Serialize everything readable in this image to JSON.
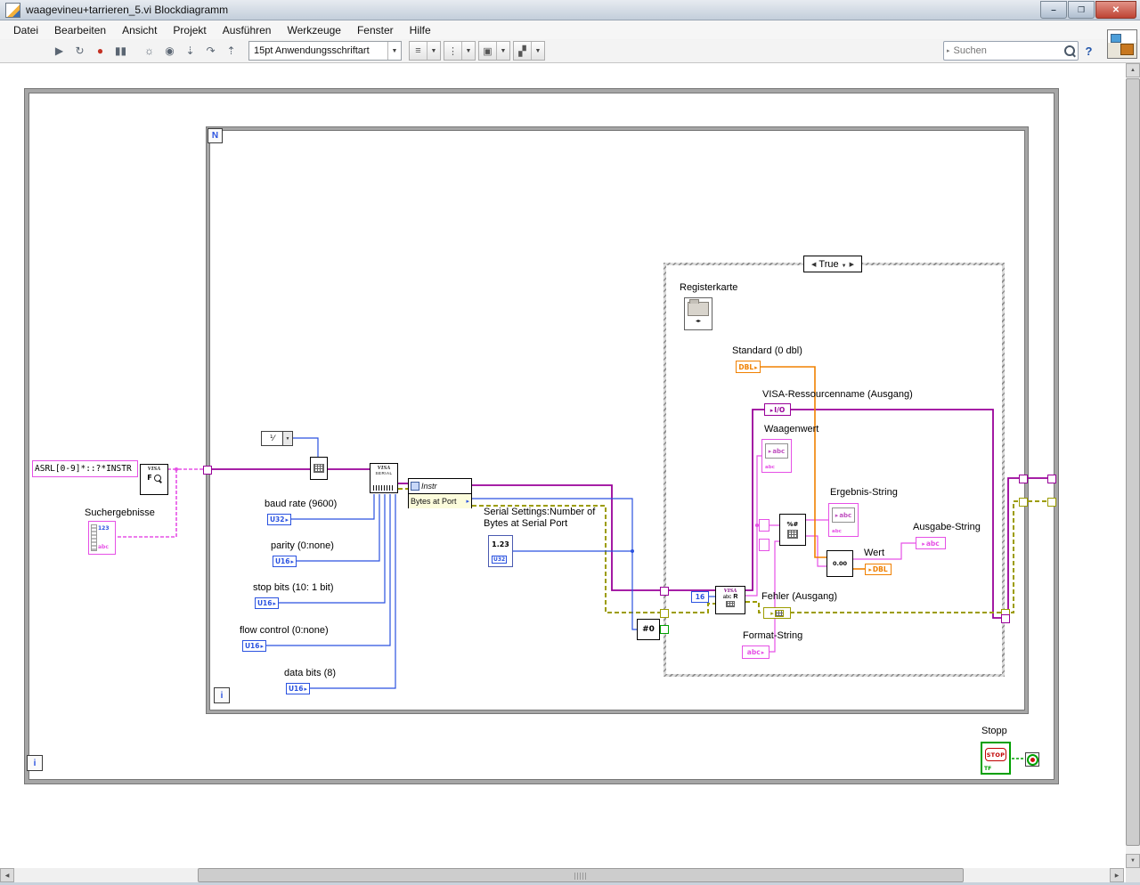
{
  "window": {
    "title": "waagevineu+tarrieren_5.vi Blockdiagramm"
  },
  "menu": {
    "items": [
      "Datei",
      "Bearbeiten",
      "Ansicht",
      "Projekt",
      "Ausführen",
      "Werkzeuge",
      "Fenster",
      "Hilfe"
    ]
  },
  "toolbar": {
    "font": "15pt Anwendungsschriftart",
    "search_placeholder": "Suchen"
  },
  "icons": {
    "run": "▶",
    "run_continuous": "↻",
    "abort": "●",
    "pause": "▮▮",
    "highlight_execution": "☼",
    "retain_wire_values": "◉",
    "step_into": "⇣",
    "step_over": "↷",
    "step_out": "⇡",
    "align": "≡",
    "distribute": "⋮",
    "resize": "▣",
    "reorder": "▞",
    "help": "?"
  },
  "diagram": {
    "while_loop": {
      "iteration": "i"
    },
    "for_loop": {
      "count": "N",
      "iteration": "i"
    },
    "case_structure": {
      "selected_case": "True"
    },
    "constants": {
      "resource_pattern": "ASRL[0-9]*::?*INSTR",
      "bytes_to_read": "16",
      "ring": "⅟"
    },
    "labels": {
      "suchergebnisse": "Suchergebnisse",
      "baud_rate": "baud rate (9600)",
      "parity": "parity (0:none)",
      "stop_bits": "stop bits (10: 1 bit)",
      "flow_control": "flow control (0:none)",
      "data_bits": "data bits (8)",
      "serial_settings": "Serial Settings:Number of Bytes at Serial Port",
      "registerkarte": "Registerkarte",
      "standard": "Standard (0 dbl)",
      "visa_ressourcenname": "VISA-Ressourcenname (Ausgang)",
      "waagenwert": "Waagenwert",
      "ergebnis_string": "Ergebnis-String",
      "ausgabe_string": "Ausgabe-String",
      "wert": "Wert",
      "fehler": "Fehler (Ausgang)",
      "format_string": "Format-String",
      "stopp": "Stopp"
    },
    "terminals": {
      "u32": "U32",
      "u16": "U16",
      "dbl": "DBL",
      "abc": "abc",
      "num": "1.23",
      "num_int": "123",
      "io": "I/O",
      "stop": "STOP",
      "tf": "TF",
      "neq": "#0"
    },
    "nodes": {
      "visa_find": {
        "title": "VISA",
        "letter": "F"
      },
      "visa_serial": {
        "l1": "VISA",
        "l2": "SERIAL"
      },
      "property_node": {
        "class": "Instr",
        "property": "Bytes at Port"
      },
      "visa_read": {
        "l1": "VISA",
        "l2": "abc",
        "l3": "R"
      },
      "scan": {
        "glyph": "%#"
      },
      "format": {
        "glyph": "0.00"
      }
    },
    "colors": {
      "visa_wire": "#990099",
      "string_wire": "#E650E6",
      "numeric_wire": "#2A52E0",
      "double_wire": "#F08000",
      "error_wire": "#9C9C00",
      "boolean_wire": "#00A000",
      "stop_border": "#00A000",
      "stop_text": "#C00000"
    }
  }
}
